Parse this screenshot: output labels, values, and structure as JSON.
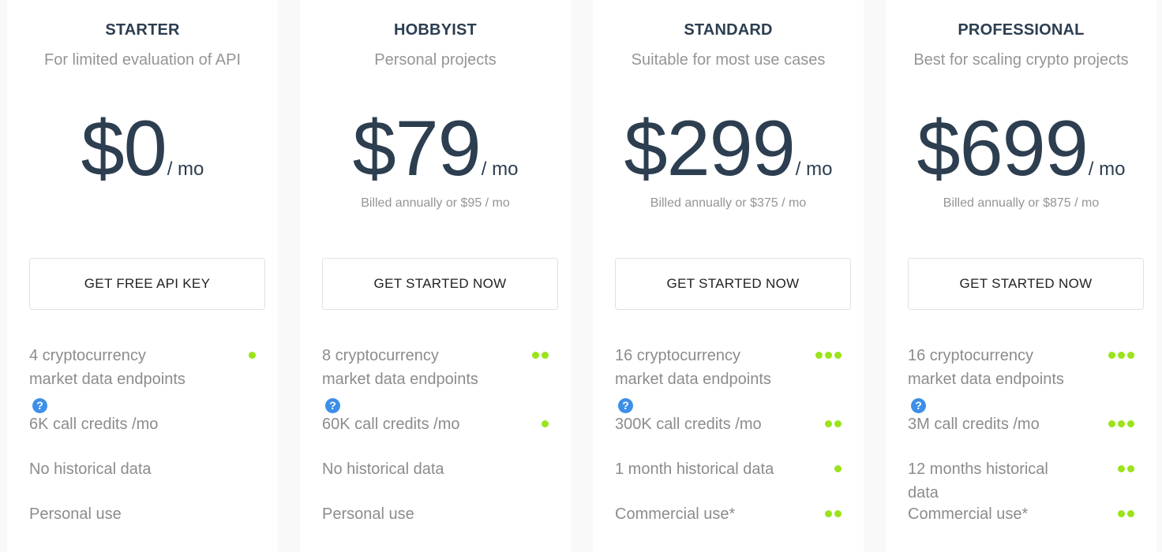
{
  "accent_color": "#9be31a",
  "help_icon_color": "#3d8fe8",
  "plans": [
    {
      "name": "STARTER",
      "description": "For limited evaluation of API",
      "price": "$0",
      "period": "/ mo",
      "billing_note": "",
      "cta_label": "GET FREE API KEY",
      "features": [
        {
          "text": "4 cryptocurrency market data endpoints",
          "help_icon": "question-circle-icon",
          "level": 1
        },
        {
          "text": "6K call credits /mo",
          "level": 0
        },
        {
          "text": "No historical data",
          "level": 0
        },
        {
          "text": "Personal use",
          "level": 0
        }
      ]
    },
    {
      "name": "HOBBYIST",
      "description": "Personal projects",
      "price": "$79",
      "period": "/ mo",
      "billing_note": "Billed annually or $95 / mo",
      "cta_label": "GET STARTED NOW",
      "features": [
        {
          "text": "8 cryptocurrency market data endpoints",
          "help_icon": "question-circle-icon",
          "level": 2
        },
        {
          "text": "60K call credits /mo",
          "level": 1
        },
        {
          "text": "No historical data",
          "level": 0
        },
        {
          "text": "Personal use",
          "level": 0
        }
      ]
    },
    {
      "name": "STANDARD",
      "description": "Suitable for most use cases",
      "price": "$299",
      "period": "/ mo",
      "billing_note": "Billed annually or $375 / mo",
      "cta_label": "GET STARTED NOW",
      "features": [
        {
          "text": "16 cryptocurrency market data endpoints",
          "help_icon": "question-circle-icon",
          "level": 3
        },
        {
          "text": "300K call credits /mo",
          "level": 2
        },
        {
          "text": "1 month historical data",
          "level": 1
        },
        {
          "text": "Commercial use*",
          "level": 2
        }
      ]
    },
    {
      "name": "PROFESSIONAL",
      "description": "Best for scaling crypto projects",
      "price": "$699",
      "period": "/ mo",
      "billing_note": "Billed annually or $875 / mo",
      "cta_label": "GET STARTED NOW",
      "features": [
        {
          "text": "16 cryptocurrency market data endpoints",
          "help_icon": "question-circle-icon",
          "level": 3
        },
        {
          "text": "3M call credits /mo",
          "level": 3
        },
        {
          "text": "12 months historical data",
          "level": 2
        },
        {
          "text": "Commercial use*",
          "level": 2
        }
      ]
    }
  ]
}
